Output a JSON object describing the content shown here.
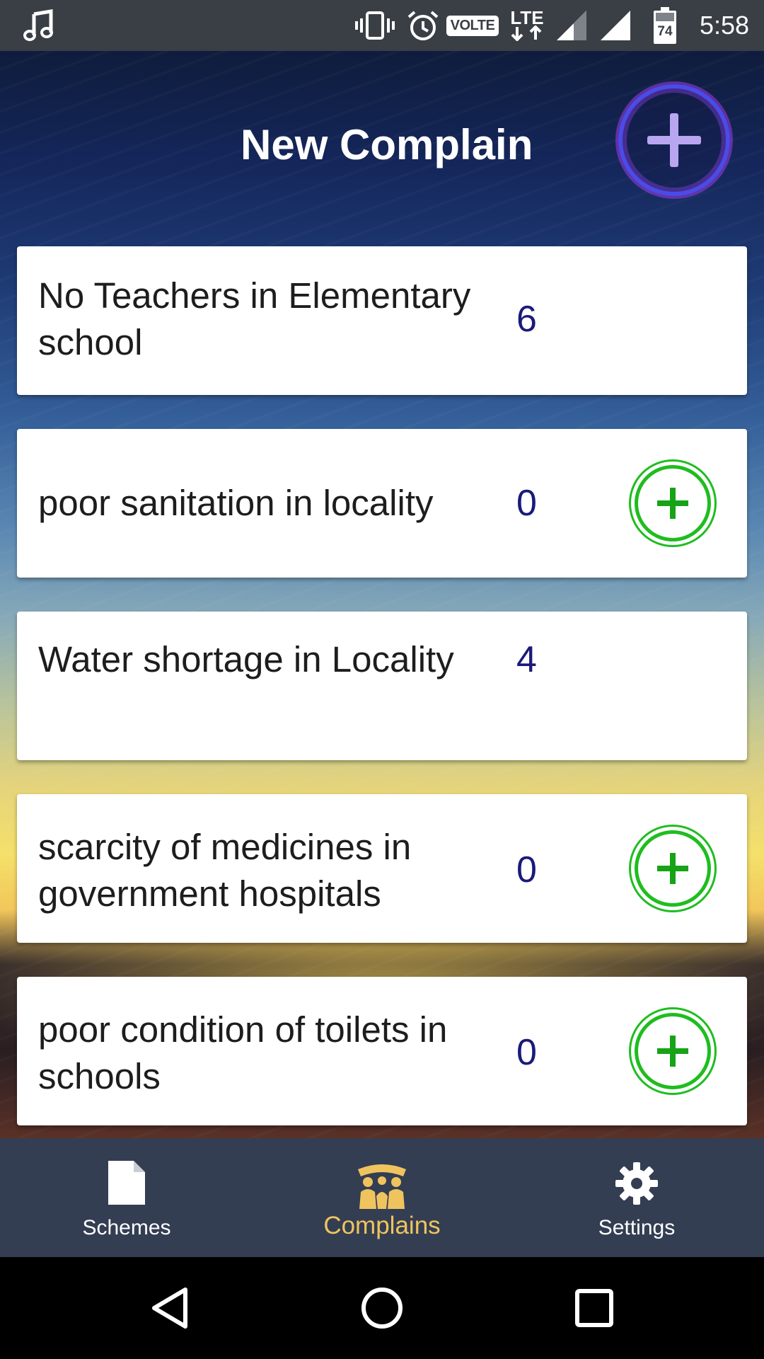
{
  "status_bar": {
    "time": "5:58",
    "volte_label": "VOLTE",
    "lte_label": "LTE",
    "battery_level": "74",
    "icons": [
      "music-note-icon",
      "vibrate-icon",
      "alarm-icon",
      "volte-icon",
      "lte-data-icon",
      "signal-icon",
      "signal-icon",
      "battery-icon"
    ]
  },
  "header": {
    "title": "New Complain",
    "add_button_icon": "plus-icon"
  },
  "complaints": [
    {
      "title": "No Teachers in Elementary school",
      "count": "6",
      "has_add_button": false
    },
    {
      "title": "poor sanitation in locality",
      "count": "0",
      "has_add_button": true
    },
    {
      "title": "Water shortage in Locality",
      "count": "4",
      "has_add_button": false
    },
    {
      "title": "scarcity of medicines in government hospitals",
      "count": "0",
      "has_add_button": true
    },
    {
      "title": "poor condition of toilets in schools",
      "count": "0",
      "has_add_button": true
    }
  ],
  "bottom_nav": {
    "items": [
      {
        "label": "Schemes",
        "icon": "document-icon",
        "active": false
      },
      {
        "label": "Complains",
        "icon": "people-icon",
        "active": true
      },
      {
        "label": "Settings",
        "icon": "gear-icon",
        "active": false
      }
    ]
  },
  "system_nav": {
    "icons": [
      "back-icon",
      "home-icon",
      "recents-icon"
    ]
  },
  "colors": {
    "status_bar": "#3a3f46",
    "count_text": "#1a1a7a",
    "add_button_green": "#1fbd1f",
    "nav_background": "#343e52",
    "nav_active": "#efc45f",
    "header_add_ring": "#4b4be8"
  }
}
